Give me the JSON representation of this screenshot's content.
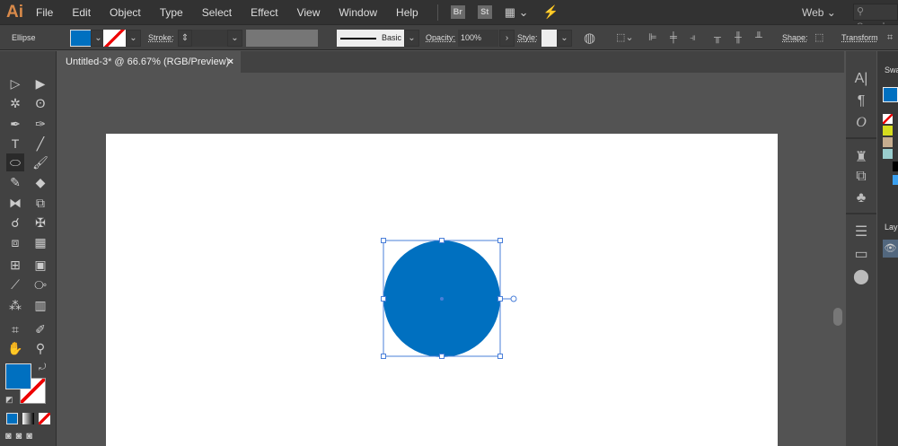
{
  "app": {
    "logo": "Ai"
  },
  "menu": [
    "File",
    "Edit",
    "Object",
    "Type",
    "Select",
    "Effect",
    "View",
    "Window",
    "Help"
  ],
  "menubar_right": {
    "br": "Br",
    "st": "St",
    "workspace": "Web",
    "search_placeholder": "Search"
  },
  "control": {
    "tool_name": "Ellipse",
    "fill_color": "#0070c0",
    "stroke_label": "Stroke:",
    "brush_label": "Basic",
    "opacity_label": "Opacity:",
    "opacity_value": "100%",
    "style_label": "Style:",
    "shape_label": "Shape:",
    "transform_label": "Transform"
  },
  "document": {
    "tab_title": "Untitled-3* @ 66.67% (RGB/Preview)",
    "close": "×"
  },
  "shape": {
    "fill": "#0070c0",
    "selection_color": "#4a7fd9"
  },
  "panels": {
    "swatches_title": "Swa",
    "layers_title": "Lay"
  }
}
